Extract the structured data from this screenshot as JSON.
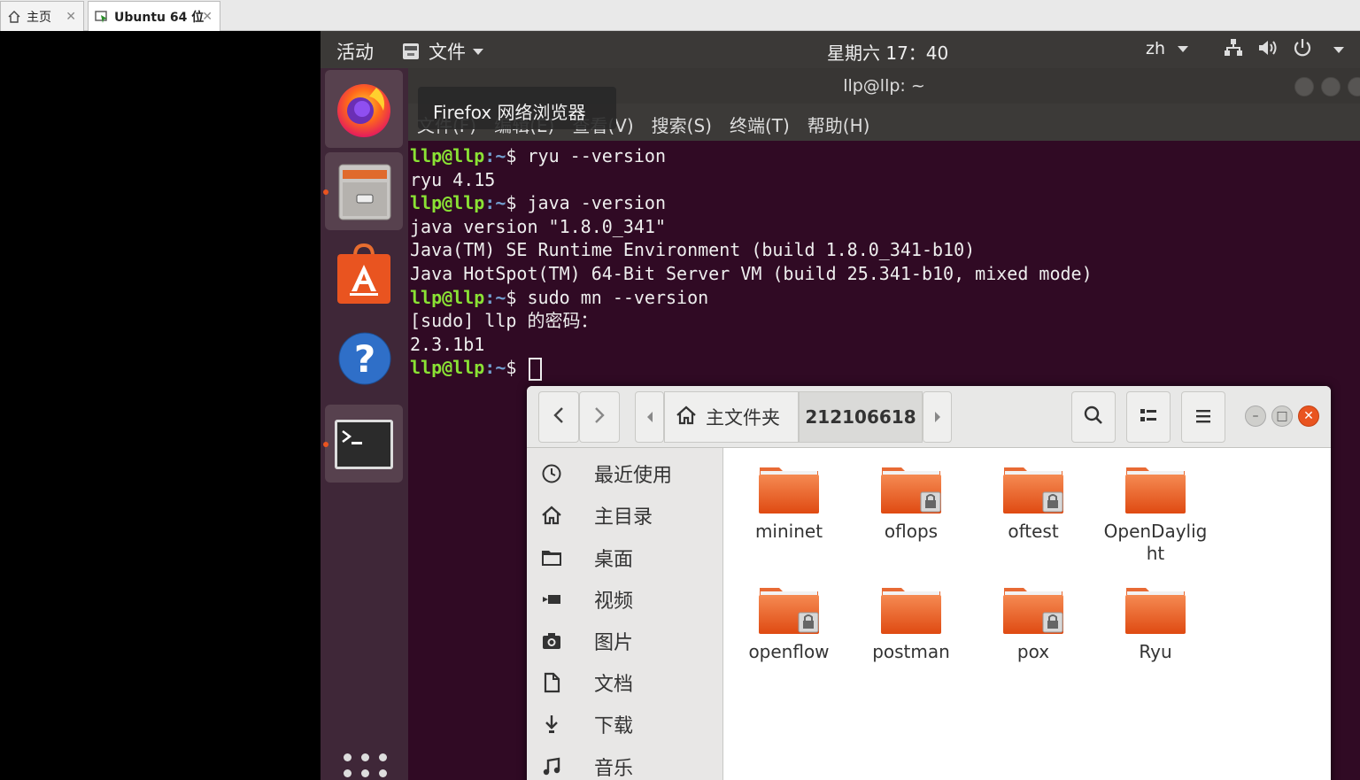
{
  "host": {
    "tabs": [
      {
        "label": "主页",
        "icon": "home-icon"
      },
      {
        "label": "Ubuntu 64 位",
        "icon": "vm-icon"
      }
    ]
  },
  "topbar": {
    "activities": "活动",
    "app_menu": "文件",
    "clock": "星期六 17：40",
    "lang": "zh"
  },
  "dock": {
    "items": [
      "firefox-icon",
      "files-icon",
      "software-center-icon",
      "help-icon",
      "terminal-icon"
    ],
    "tooltip": "Firefox 网络浏览器"
  },
  "terminal": {
    "title": "llp@llp: ~",
    "menu": [
      "文件(F)",
      "编辑(E)",
      "查看(V)",
      "搜索(S)",
      "终端(T)",
      "帮助(H)"
    ],
    "prompt_user": "llp@llp",
    "prompt_path": ":~",
    "prompt_sym": "$ ",
    "lines": [
      {
        "type": "cmd",
        "text": "ryu --version"
      },
      {
        "type": "out",
        "text": "ryu 4.15"
      },
      {
        "type": "cmd",
        "text": "java -version"
      },
      {
        "type": "out",
        "text": "java version \"1.8.0_341\""
      },
      {
        "type": "out",
        "text": "Java(TM) SE Runtime Environment (build 1.8.0_341-b10)"
      },
      {
        "type": "out",
        "text": "Java HotSpot(TM) 64-Bit Server VM (build 25.341-b10, mixed mode)"
      },
      {
        "type": "cmd",
        "text": "sudo mn --version"
      },
      {
        "type": "out",
        "text": "[sudo] llp 的密码："
      },
      {
        "type": "out",
        "text": "2.3.1b1"
      },
      {
        "type": "cmd",
        "text": ""
      }
    ]
  },
  "files": {
    "breadcrumb_home": "主文件夹",
    "breadcrumb_current": "212106618",
    "sidebar": [
      {
        "label": "最近使用",
        "icon": "clock-icon"
      },
      {
        "label": "主目录",
        "icon": "home-icon"
      },
      {
        "label": "桌面",
        "icon": "folder-icon"
      },
      {
        "label": "视频",
        "icon": "video-icon"
      },
      {
        "label": "图片",
        "icon": "camera-icon"
      },
      {
        "label": "文档",
        "icon": "document-icon"
      },
      {
        "label": "下载",
        "icon": "download-icon"
      },
      {
        "label": "音乐",
        "icon": "music-icon"
      }
    ],
    "folders": [
      {
        "name": "mininet",
        "locked": false
      },
      {
        "name": "oflops",
        "locked": true
      },
      {
        "name": "oftest",
        "locked": true
      },
      {
        "name": "OpenDaylig\nht",
        "locked": false
      },
      {
        "name": "openflow",
        "locked": true
      },
      {
        "name": "postman",
        "locked": false
      },
      {
        "name": "pox",
        "locked": true
      },
      {
        "name": "Ryu",
        "locked": false
      }
    ]
  }
}
